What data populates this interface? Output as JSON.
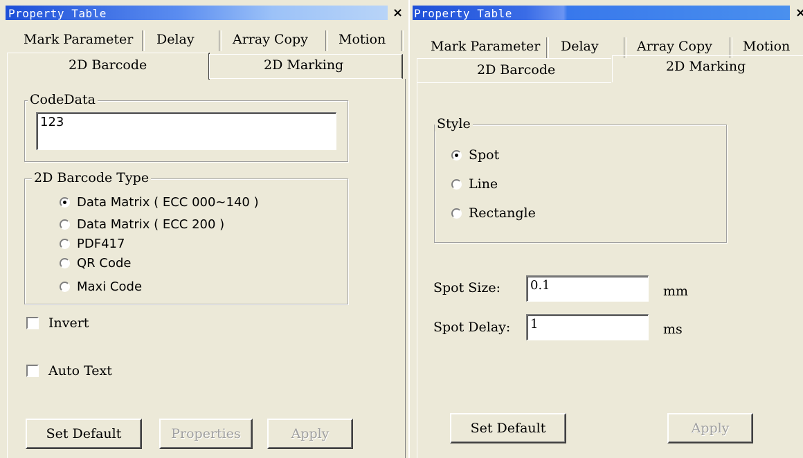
{
  "left": {
    "title": "Property Table",
    "close_glyph": "×",
    "tabs_row1": [
      "Mark Parameter",
      "Delay",
      "Array Copy",
      "Motion"
    ],
    "tabs_row2": [
      "2D Barcode",
      "2D Marking"
    ],
    "active_tab": "2D Barcode",
    "codedata": {
      "legend": "CodeData",
      "value": "123"
    },
    "barcode_type": {
      "legend": "2D Barcode Type",
      "options": [
        "Data Matrix ( ECC 000~140 )",
        "Data Matrix ( ECC 200 )",
        "PDF417",
        "QR Code",
        "Maxi Code"
      ],
      "selected": "Data Matrix ( ECC 000~140 )"
    },
    "invert_label": "Invert",
    "invert_checked": false,
    "auto_text_label": "Auto Text",
    "auto_text_checked": false,
    "buttons": {
      "set_default": "Set Default",
      "properties": "Properties",
      "apply": "Apply"
    }
  },
  "right": {
    "title": "Property Table",
    "close_glyph": "×",
    "tabs_row1": [
      "Mark Parameter",
      "Delay",
      "Array Copy",
      "Motion"
    ],
    "tabs_row2": [
      "2D Barcode",
      "2D Marking"
    ],
    "active_tab": "2D Marking",
    "style": {
      "legend": "Style",
      "options": [
        "Spot",
        "Line",
        "Rectangle"
      ],
      "selected": "Spot"
    },
    "spot_size": {
      "label": "Spot Size:",
      "value": "0.1",
      "unit": "mm"
    },
    "spot_delay": {
      "label": "Spot Delay:",
      "value": "1",
      "unit": "ms"
    },
    "buttons": {
      "set_default": "Set Default",
      "apply": "Apply"
    }
  }
}
